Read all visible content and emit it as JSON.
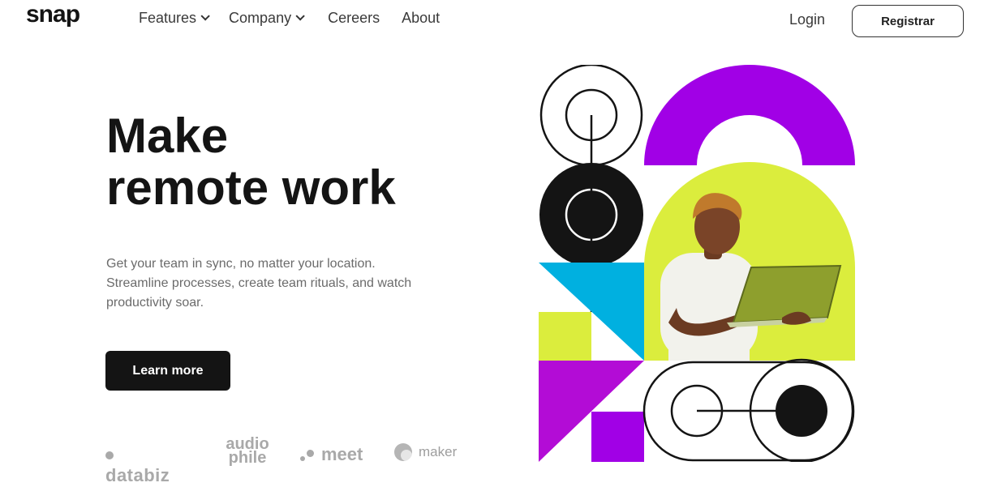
{
  "header": {
    "logo": "snap",
    "nav": [
      {
        "label": "Features",
        "has_dropdown": true
      },
      {
        "label": "Company",
        "has_dropdown": true
      },
      {
        "label": "Cereers",
        "has_dropdown": false
      },
      {
        "label": "About",
        "has_dropdown": false
      }
    ],
    "login_label": "Login",
    "register_label": "Registrar"
  },
  "hero": {
    "title_line1": "Make",
    "title_line2": "remote work",
    "description": "Get your team in sync, no matter your location. Streamline processes, create team rituals, and watch productivity soar.",
    "cta_label": "Learn more"
  },
  "clients": {
    "databiz": "databiz",
    "audiophile_line1": "audio",
    "audiophile_line2": "phile",
    "meet": "meet",
    "maker": "maker"
  },
  "icons": {
    "dropdown": "chevron-down-icon"
  },
  "colors": {
    "accent_dark": "#141414",
    "purple": "#a100e6",
    "yellow_green": "#dbed3d",
    "cyan": "#00b0e0",
    "magenta": "#b30cd6",
    "muted_text": "#6b6b6b",
    "logo_gray": "#a9a9a9"
  }
}
